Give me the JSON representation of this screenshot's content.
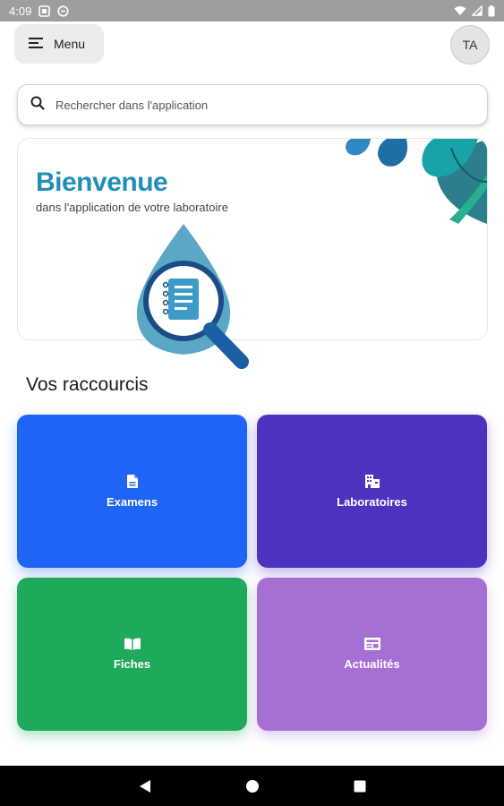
{
  "status_bar": {
    "time": "4:09"
  },
  "header": {
    "menu_label": "Menu",
    "avatar_initials": "TA"
  },
  "search": {
    "placeholder": "Rechercher dans l'application"
  },
  "banner": {
    "title": "Bienvenue",
    "subtitle": "dans l'application de votre laboratoire"
  },
  "shortcuts": {
    "title": "Vos raccourcis",
    "items": [
      {
        "label": "Examens",
        "icon": "document-icon",
        "color": "#1f64f4"
      },
      {
        "label": "Laboratoires",
        "icon": "building-icon",
        "color": "#4e32bf"
      },
      {
        "label": "Fiches",
        "icon": "book-icon",
        "color": "#1fa95b"
      },
      {
        "label": "Actualités",
        "icon": "newspaper-icon",
        "color": "#a66fd4"
      }
    ]
  },
  "nav_bar": {
    "buttons": [
      "back",
      "home",
      "recents"
    ]
  }
}
